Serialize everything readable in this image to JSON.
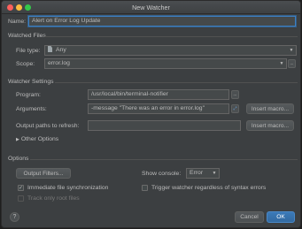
{
  "window": {
    "title": "New Watcher"
  },
  "name": {
    "label": "Name:",
    "value": "Alert on Error Log Update"
  },
  "watched_files": {
    "header": "Watched Files",
    "file_type": {
      "label": "File type:",
      "value": "Any",
      "icon": "file-icon"
    },
    "scope": {
      "label": "Scope:",
      "value": "error.log",
      "more": "..."
    }
  },
  "watcher_settings": {
    "header": "Watcher Settings",
    "program": {
      "label": "Program:",
      "value": "/usr/local/bin/terminal-notifier",
      "more": "..."
    },
    "arguments": {
      "label": "Arguments:",
      "value": "-message \"There was an error in error.log\"",
      "insert_macro": "Insert macro..."
    },
    "output_paths": {
      "label": "Output paths to refresh:",
      "value": "",
      "insert_macro": "Insert macro..."
    },
    "other_options": "Other Options"
  },
  "options": {
    "header": "Options",
    "output_filters": "Output Filters...",
    "show_console": {
      "label": "Show console:",
      "value": "Error"
    },
    "immediate_sync": {
      "label": "Immediate file synchronization",
      "checked": true
    },
    "trigger_regardless": {
      "label": "Trigger watcher regardless of syntax errors",
      "checked": false
    },
    "track_only_root": {
      "label": "Track only root files",
      "checked": false,
      "disabled": true
    }
  },
  "footer": {
    "help": "?",
    "cancel": "Cancel",
    "ok": "OK"
  },
  "colors": {
    "accent": "#3d7fc1",
    "panel": "#3c3f41",
    "ok_button": "#3b79b8"
  }
}
